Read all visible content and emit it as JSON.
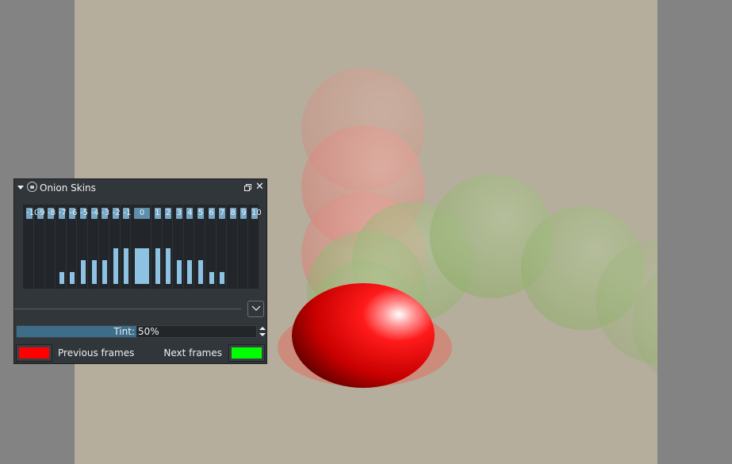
{
  "docker": {
    "title": "Onion Skins",
    "frames": [
      {
        "label": "-10",
        "opacity": 0
      },
      {
        "label": "-9",
        "opacity": 0
      },
      {
        "label": "-8",
        "opacity": 0
      },
      {
        "label": "-7",
        "opacity": 0.15
      },
      {
        "label": "-6",
        "opacity": 0.15
      },
      {
        "label": "-5",
        "opacity": 0.3
      },
      {
        "label": "-4",
        "opacity": 0.3
      },
      {
        "label": "-3",
        "opacity": 0.3
      },
      {
        "label": "-2",
        "opacity": 0.45
      },
      {
        "label": "-1",
        "opacity": 0.45
      },
      {
        "label": "0",
        "opacity": 0.45,
        "current": true
      },
      {
        "label": "1",
        "opacity": 0.45
      },
      {
        "label": "2",
        "opacity": 0.45
      },
      {
        "label": "3",
        "opacity": 0.3
      },
      {
        "label": "4",
        "opacity": 0.3
      },
      {
        "label": "5",
        "opacity": 0.3
      },
      {
        "label": "6",
        "opacity": 0.15
      },
      {
        "label": "7",
        "opacity": 0.15
      },
      {
        "label": "8",
        "opacity": 0
      },
      {
        "label": "9",
        "opacity": 0
      },
      {
        "label": "10",
        "opacity": 0
      }
    ],
    "tint": {
      "label": "Tint:",
      "value": "50%",
      "fraction": 0.5
    },
    "previous_frames_label": "Previous frames",
    "next_frames_label": "Next frames",
    "previous_color": "#ff0000",
    "next_color": "#00ff00"
  },
  "colors": {
    "canvas_bg": "#b5ae9c",
    "workspace_bg": "#838383",
    "accent": "#8ec2e2"
  },
  "icons": [
    "collapse-arrow-icon",
    "lock-icon",
    "float-icon",
    "close-icon",
    "chevron-down-icon",
    "spin-up-icon",
    "spin-down-icon"
  ]
}
